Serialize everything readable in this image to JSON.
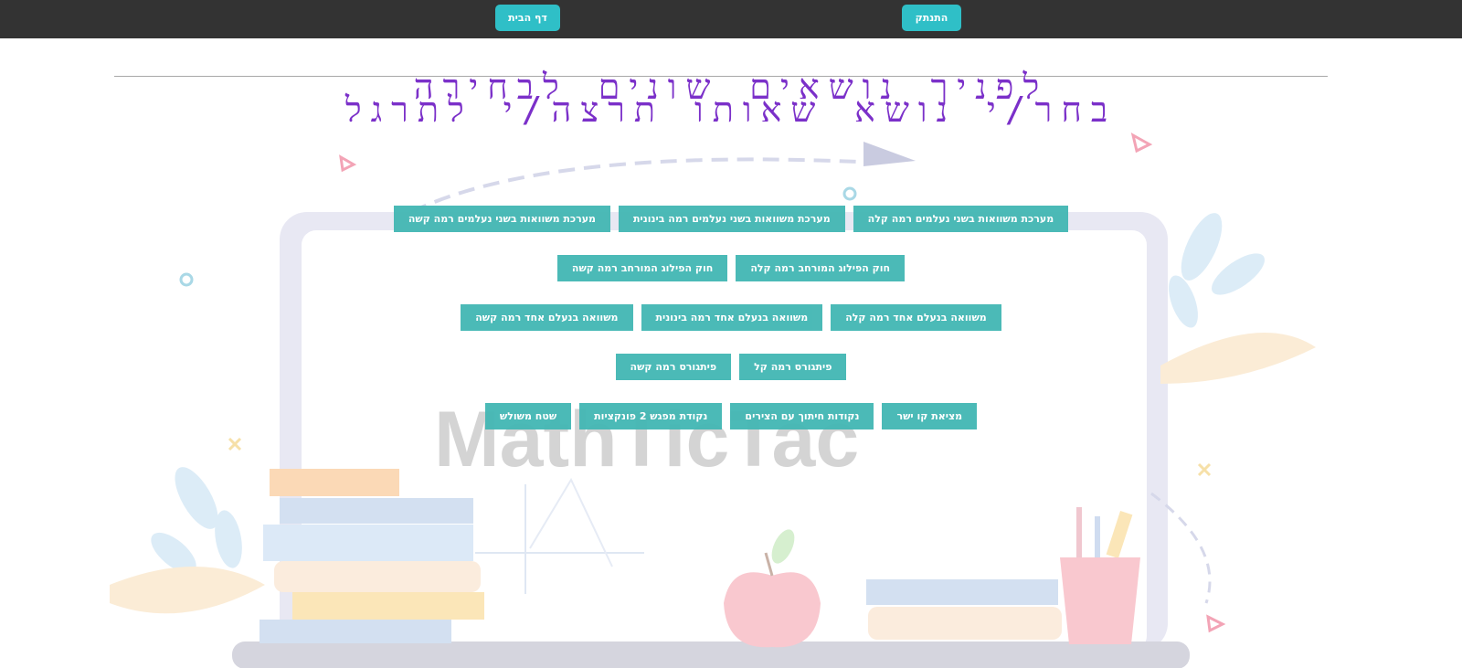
{
  "nav": {
    "home_label": "דף הבית",
    "logout_label": "התנתק"
  },
  "heading": {
    "line1": "לפניך נושאים שונים לבחירה",
    "line2": "בחר/י נושא שאותו תרצה/י לתרגל"
  },
  "background": {
    "logo_text": "MathTicTac"
  },
  "topics": {
    "rows": [
      [
        "מערכת משוואות בשני נעלמים רמה קלה",
        "מערכת משוואות בשני נעלמים רמה בינונית",
        "מערכת משוואות בשני נעלמים רמה קשה"
      ],
      [
        "חוק הפילוג המורחב רמה קלה",
        "חוק הפילוג המורחב רמה קשה"
      ],
      [
        "משוואה בנעלם אחד רמה קלה",
        "משוואה בנעלם אחד רמה בינונית",
        "משוואה בנעלם אחד רמה קשה"
      ],
      [
        "פיתגורס רמה קל",
        "פיתגורס רמה קשה"
      ],
      [
        "מציאת קו ישר",
        "נקודות חיתוך עם הצירים",
        "נקודת מפגש 2 פונקציות",
        "שטח משולש"
      ]
    ]
  },
  "colors": {
    "topbar": "#333333",
    "nav_button": "#2fbfc7",
    "topic_button": "#46b8b5",
    "heading": "#7b30c9"
  }
}
